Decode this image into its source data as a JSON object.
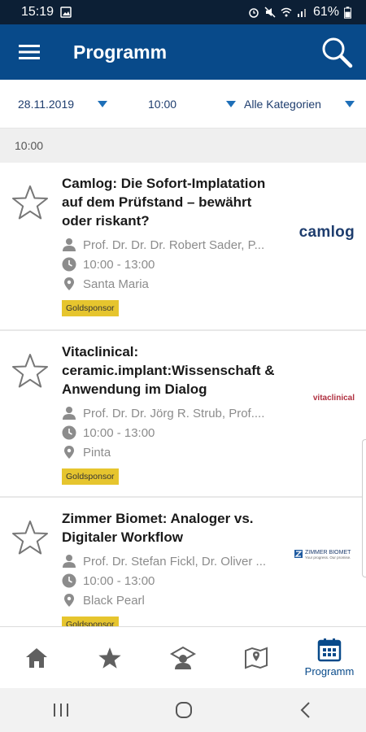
{
  "status_bar": {
    "time": "15:19",
    "battery": "61%"
  },
  "app_bar": {
    "title": "Programm"
  },
  "filters": {
    "date": "28.11.2019",
    "time": "10:00",
    "category": "Alle Kategorien"
  },
  "section": {
    "time": "10:00"
  },
  "sessions": [
    {
      "title": "Camlog: Die Sofort-Implatation auf dem Prüfstand – bewährt oder riskant?",
      "speakers": "Prof. Dr. Dr. Dr. Robert Sader, P...",
      "time": "10:00 - 13:00",
      "location": "Santa Maria",
      "badge": "Goldsponsor",
      "sponsor_logo": "camlog"
    },
    {
      "title": "Vitaclinical: ceramic.implant:Wissenschaft & Anwendung im Dialog",
      "speakers": "Prof. Dr. Dr. Jörg R. Strub, Prof....",
      "time": "10:00 - 13:00",
      "location": "Pinta",
      "badge": "Goldsponsor",
      "sponsor_logo": "vitaclinical"
    },
    {
      "title": "Zimmer Biomet: Analoger vs. Digitaler Workflow",
      "speakers": "Prof. Dr. Stefan Fickl, Dr. Oliver ...",
      "time": "10:00 - 13:00",
      "location": "Black Pearl",
      "badge": "Goldsponsor",
      "sponsor_logo": "ZIMMER BIOMET",
      "sponsor_tagline": "Your progress. Our promise."
    }
  ],
  "bottom_nav": {
    "active_label": "Programm"
  },
  "colors": {
    "primary": "#084a8a",
    "status_bar": "#0c1f35",
    "badge": "#e6c52e",
    "accent": "#1e6fb8"
  }
}
